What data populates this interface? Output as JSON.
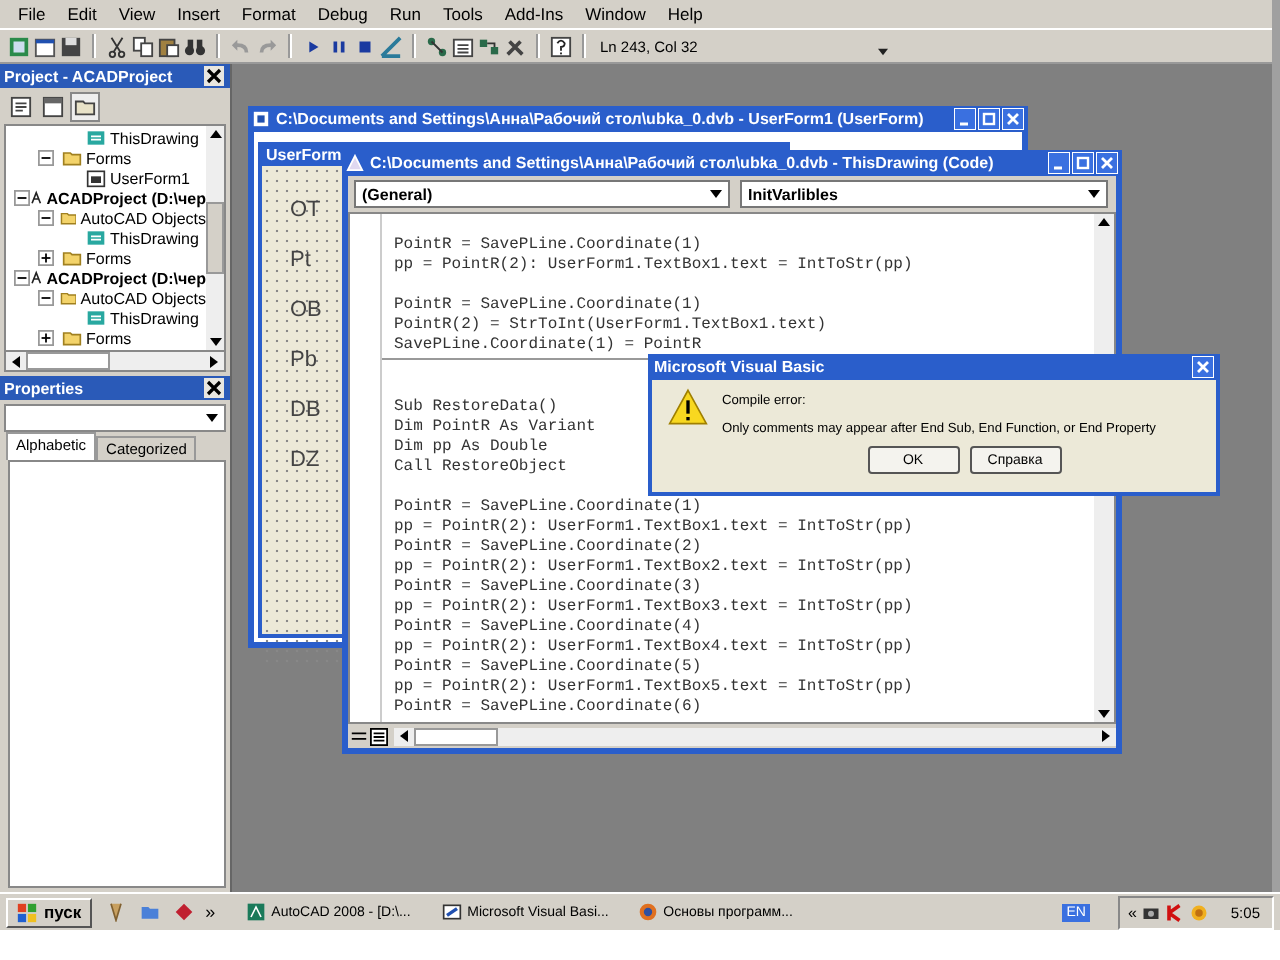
{
  "menu": [
    "File",
    "Edit",
    "View",
    "Insert",
    "Format",
    "Debug",
    "Run",
    "Tools",
    "Add-Ins",
    "Window",
    "Help"
  ],
  "toolbar": {
    "position": "Ln 243, Col 32"
  },
  "project_panel": {
    "title": "Project - ACADProject",
    "tree": [
      {
        "children": [
          {
            "children": [
              {
                "label": "ThisDrawing",
                "kind": "object"
              }
            ]
          },
          {
            "label": "Forms",
            "kind": "folder",
            "expanded": true,
            "children": [
              {
                "label": "UserForm1",
                "kind": "form"
              }
            ]
          }
        ]
      },
      {
        "label": "ACADProject (D:\\чер",
        "kind": "project",
        "expanded": true,
        "children": [
          {
            "label": "AutoCAD Objects",
            "kind": "folder",
            "expanded": true,
            "children": [
              {
                "label": "ThisDrawing",
                "kind": "object"
              }
            ]
          },
          {
            "label": "Forms",
            "kind": "folder",
            "expanded": false
          }
        ]
      },
      {
        "label": "ACADProject (D:\\чер",
        "kind": "project",
        "expanded": true,
        "children": [
          {
            "label": "AutoCAD Objects",
            "kind": "folder",
            "expanded": true,
            "children": [
              {
                "label": "ThisDrawing",
                "kind": "object"
              }
            ]
          },
          {
            "label": "Forms",
            "kind": "folder",
            "expanded": false
          }
        ]
      }
    ]
  },
  "properties_panel": {
    "title": "Properties",
    "tabs": [
      {
        "label": "Alphabetic",
        "selected": true
      },
      {
        "label": "Categorized",
        "selected": false
      }
    ]
  },
  "userform_window": {
    "title": "C:\\Documents and Settings\\Анна\\Рабочий стол\\ubka_0.dvb - UserForm1 (UserForm)",
    "form_title": "UserForm",
    "labels": [
      "OT",
      "Pt",
      "OB",
      "Pb",
      "DB",
      "DZ"
    ]
  },
  "code_window": {
    "title": "C:\\Documents and Settings\\Анна\\Рабочий стол\\ubka_0.dvb - ThisDrawing (Code)",
    "object_dropdown": "(General)",
    "procedure_dropdown": "InitVarlibles",
    "procedures": [
      {
        "paragraphs": [
          [
            "PointR = SavePLine.Coordinate(1)",
            "pp = PointR(2): UserForm1.TextBox1.text = IntToStr(pp)"
          ],
          [
            "PointR = SavePLine.Coordinate(1)",
            "PointR(2) = StrToInt(UserForm1.TextBox1.text)",
            "SavePLine.Coordinate(1) = PointR"
          ]
        ]
      },
      {
        "paragraphs": [
          [
            "Sub RestoreData()",
            "Dim PointR As Variant",
            "Dim pp As Double",
            "Call RestoreObject"
          ],
          [
            "PointR = SavePLine.Coordinate(1)",
            "pp = PointR(2): UserForm1.TextBox1.text = IntToStr(pp)",
            "PointR = SavePLine.Coordinate(2)",
            "pp = PointR(2): UserForm1.TextBox2.text = IntToStr(pp)",
            "PointR = SavePLine.Coordinate(3)",
            "pp = PointR(2): UserForm1.TextBox3.text = IntToStr(pp)",
            "PointR = SavePLine.Coordinate(4)",
            "pp = PointR(2): UserForm1.TextBox4.text = IntToStr(pp)",
            "PointR = SavePLine.Coordinate(5)",
            "pp = PointR(2): UserForm1.TextBox5.text = IntToStr(pp)",
            "PointR = SavePLine.Coordinate(6)"
          ]
        ]
      }
    ]
  },
  "dialog": {
    "title": "Microsoft Visual Basic",
    "heading": "Compile error:",
    "message": "Only comments may appear after End Sub, End Function, or End Property",
    "buttons": [
      "OK",
      "Справка"
    ]
  },
  "taskbar": {
    "start": "пуск",
    "more": "»",
    "tasks": [
      "AutoCAD 2008 - [D:\\...",
      "Microsoft Visual Basi...",
      "Основы программ..."
    ],
    "language": "EN",
    "tray_toggle": "«",
    "clock": "5:05"
  }
}
